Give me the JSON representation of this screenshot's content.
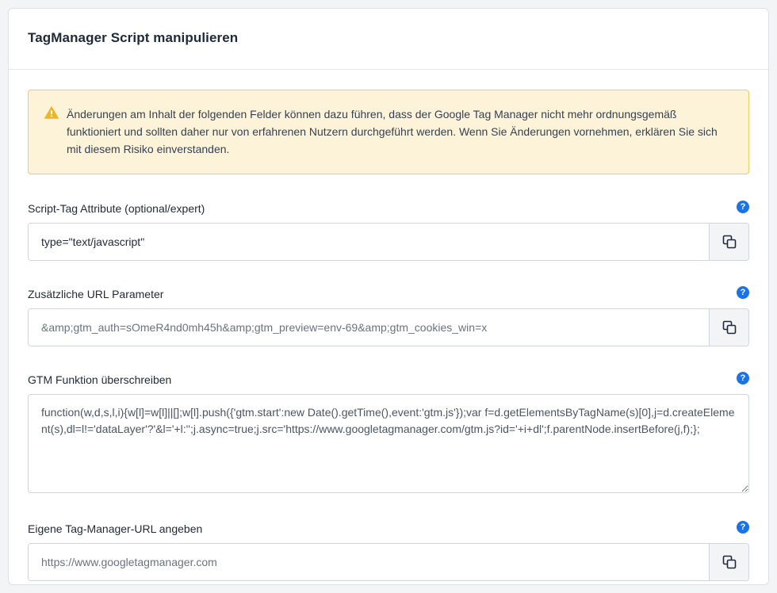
{
  "page": {
    "title": "TagManager Script manipulieren"
  },
  "alert": {
    "icon": "warning-icon",
    "color": "#f0b429",
    "text": "Änderungen am Inhalt der folgenden Felder können dazu führen, dass der Google Tag Manager nicht mehr ordnungsgemäß funktioniert und sollten daher nur von erfahrenen Nutzern durchgeführt werden. Wenn Sie Änderungen vornehmen, erklären Sie sich mit diesem Risiko einverstanden."
  },
  "fields": {
    "script_attrs": {
      "label": "Script-Tag Attribute (optional/expert)",
      "value": "type=\"text/javascript\"",
      "help": "?"
    },
    "url_params": {
      "label": "Zusätzliche URL Parameter",
      "placeholder": "&amp;gtm_auth=sOmeR4nd0mh45h&amp;gtm_preview=env-69&amp;gtm_cookies_win=x",
      "help": "?"
    },
    "gtm_function": {
      "label": "GTM Funktion überschreiben",
      "value": "function(w,d,s,l,i){w[l]=w[l]||[];w[l].push({'gtm.start':new Date().getTime(),event:'gtm.js'});var f=d.getElementsByTagName(s)[0],j=d.createElement(s),dl=l!='dataLayer'?'&l='+l:'';j.async=true;j.src='https://www.googletagmanager.com/gtm.js?id='+i+dl';f.parentNode.insertBefore(j,f);};",
      "help": "?"
    },
    "custom_url": {
      "label": "Eigene Tag-Manager-URL angeben",
      "placeholder": "https://www.googletagmanager.com",
      "help": "?"
    }
  },
  "colors": {
    "accent": "#1a73e8",
    "alert_bg": "#fdf3d8",
    "alert_border": "#f2c96b"
  }
}
